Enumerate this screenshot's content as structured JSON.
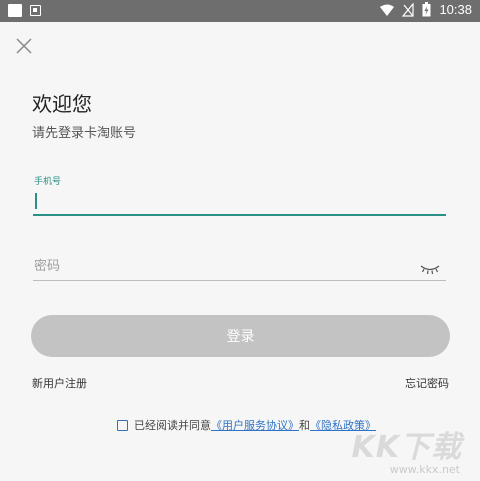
{
  "status_bar": {
    "time": "10:38",
    "icons": [
      "notification-square-icon",
      "app-notification-icon",
      "wifi-icon",
      "no-signal-icon",
      "battery-icon"
    ]
  },
  "header": {
    "close_icon": "close-icon"
  },
  "main": {
    "welcome": "欢迎您",
    "subtitle": "请先登录卡淘账号",
    "phone_label": "手机号",
    "phone_value": "",
    "password_placeholder": "密码",
    "password_value": "",
    "eye_icon": "eye-closed-icon",
    "login_label": "登录",
    "register_label": "新用户注册",
    "forgot_label": "忘记密码",
    "agree_prefix": "已经阅读并同意",
    "terms_link": "《用户服务协议》",
    "and_text": "和",
    "privacy_link": "《隐私政策》"
  },
  "watermark": {
    "main": "KK下载",
    "url": "www.kkx.net"
  },
  "colors": {
    "accent": "#2a8f84",
    "link": "#2f73c4",
    "button_disabled": "#c3c3c3",
    "status_bar": "#6e6e6e"
  }
}
